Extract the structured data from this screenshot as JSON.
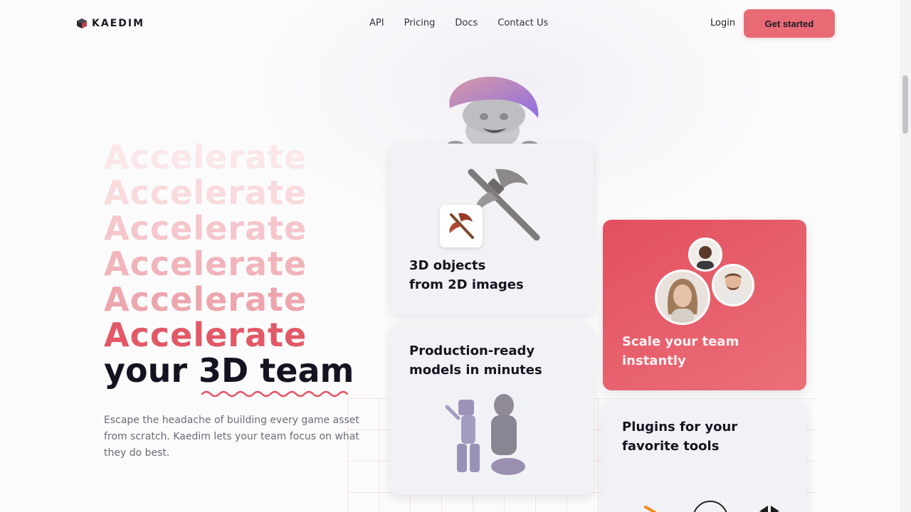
{
  "brand": {
    "name": "KAEDIM",
    "accent": "#e86a75"
  },
  "nav": {
    "items": [
      {
        "label": "API"
      },
      {
        "label": "Pricing"
      },
      {
        "label": "Docs"
      },
      {
        "label": "Contact Us"
      }
    ],
    "login": "Login",
    "cta": "Get started"
  },
  "hero": {
    "repeat_word": "Accelerate",
    "line_prefix": "your",
    "line_highlight": "3D team",
    "lede": "Escape the headache of building every game asset from scratch. Kaedim lets your team focus on what they do best."
  },
  "cards": {
    "objects": {
      "line1": "3D objects",
      "line2": "from 2D images",
      "icon": "axe-icon"
    },
    "production": {
      "line1": "Production-ready",
      "line2": "models in minutes",
      "icon": "character-models-icon"
    },
    "scale": {
      "line1": "Scale your team",
      "line2": "instantly",
      "icon": "team-avatars-icon"
    },
    "plugins": {
      "line1": "Plugins for your",
      "line2": "favorite tools",
      "icon": "plugin-logos-icon"
    }
  }
}
